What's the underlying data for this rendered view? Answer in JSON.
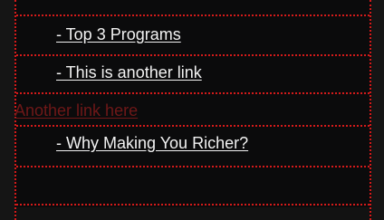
{
  "menu": {
    "items": [
      {
        "label": "- Top 3 Programs"
      },
      {
        "label": "- This is another link"
      },
      {
        "label": "Another link here"
      },
      {
        "label": "- Why Making You Richer?"
      }
    ]
  },
  "colors": {
    "border": "#d41a1a",
    "link": "#f2f2f2",
    "muted_link": "#6f1818",
    "background": "#0b0b0c"
  }
}
